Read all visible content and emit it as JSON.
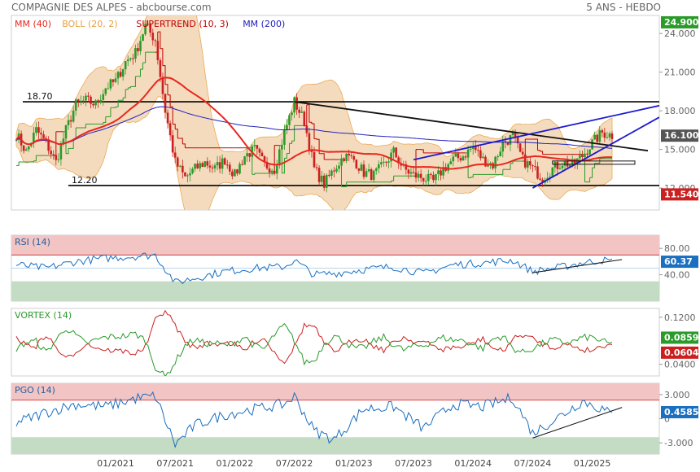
{
  "header": {
    "title": "COMPAGNIE DES ALPES - abcbourse.com",
    "period": "5 ANS - HEBDO"
  },
  "colors": {
    "mm40": "#e8281e",
    "boll": "#e8a040",
    "boll_fill": "#f4d8b8",
    "supertrend": "#c00000",
    "mm200": "#2020c0",
    "green": "#2a9a2a",
    "red": "#cc2020",
    "blue": "#1a6fc0",
    "overbought": "#f2c4c4",
    "oversold": "#c4dcc4"
  },
  "chart_data": [
    {
      "id": "price",
      "type": "candlestick",
      "legend": [
        {
          "key": "mm40",
          "label": "MM (40)"
        },
        {
          "key": "boll",
          "label": "BOLL (20, 2)"
        },
        {
          "key": "supertrend",
          "label": "SUPERTREND (10, 3)"
        },
        {
          "key": "mm200",
          "label": "MM (200)"
        }
      ],
      "ylim": [
        10.3,
        25.4
      ],
      "yticks": [
        "24.000",
        "21.000",
        "18.000",
        "15.000",
        "12.000"
      ],
      "ytick_values": [
        24,
        21,
        18,
        15,
        12
      ],
      "xticks": [
        "01/2021",
        "07/2021",
        "01/2022",
        "07/2022",
        "01/2023",
        "07/2023",
        "01/2024",
        "07/2024",
        "01/2025"
      ],
      "xtick_dates": [
        "2021-01",
        "2021-07",
        "2022-01",
        "2022-07",
        "2023-01",
        "2023-07",
        "2024-01",
        "2024-07",
        "2025-01"
      ],
      "xrange": [
        "2020-03",
        "2025-03"
      ],
      "levels": [
        {
          "label": "18.70",
          "value": 18.7
        },
        {
          "label": "12.20",
          "value": 12.2
        }
      ],
      "price_tags": [
        {
          "label": "24.900",
          "value": 24.9,
          "color": "#2a9a2a"
        },
        {
          "label": "16.100",
          "value": 16.1,
          "color": "#555555"
        },
        {
          "label": "11.540",
          "value": 11.54,
          "color": "#cc2020"
        }
      ],
      "close_path": [
        [
          "2020-03",
          16.2
        ],
        [
          "2020-04",
          14.8
        ],
        [
          "2020-05",
          16.5
        ],
        [
          "2020-06",
          15.5
        ],
        [
          "2020-07",
          14.0
        ],
        [
          "2020-08",
          16.5
        ],
        [
          "2020-09",
          18.5
        ],
        [
          "2020-10",
          18.8
        ],
        [
          "2020-11",
          18.5
        ],
        [
          "2020-12",
          19.8
        ],
        [
          "2021-01",
          20.3
        ],
        [
          "2021-02",
          21.8
        ],
        [
          "2021-03",
          22.5
        ],
        [
          "2021-04",
          24.6
        ],
        [
          "2021-05",
          23.5
        ],
        [
          "2021-06",
          18.0
        ],
        [
          "2021-07",
          14.0
        ],
        [
          "2021-08",
          12.8
        ],
        [
          "2021-09",
          13.5
        ],
        [
          "2021-10",
          14.0
        ],
        [
          "2021-11",
          13.5
        ],
        [
          "2021-12",
          14.2
        ],
        [
          "2022-01",
          13.0
        ],
        [
          "2022-02",
          14.5
        ],
        [
          "2022-03",
          15.0
        ],
        [
          "2022-04",
          13.8
        ],
        [
          "2022-05",
          13.5
        ],
        [
          "2022-06",
          16.3
        ],
        [
          "2022-07",
          18.7
        ],
        [
          "2022-08",
          17.2
        ],
        [
          "2022-09",
          13.5
        ],
        [
          "2022-10",
          12.3
        ],
        [
          "2022-11",
          13.5
        ],
        [
          "2022-12",
          14.5
        ],
        [
          "2023-01",
          14.2
        ],
        [
          "2023-02",
          13.2
        ],
        [
          "2023-03",
          13.0
        ],
        [
          "2023-04",
          13.8
        ],
        [
          "2023-05",
          14.8
        ],
        [
          "2023-06",
          13.5
        ],
        [
          "2023-07",
          13.0
        ],
        [
          "2023-08",
          12.8
        ],
        [
          "2023-09",
          12.5
        ],
        [
          "2023-10",
          13.5
        ],
        [
          "2023-11",
          14.2
        ],
        [
          "2023-12",
          14.5
        ],
        [
          "2024-01",
          15.2
        ],
        [
          "2024-02",
          14.2
        ],
        [
          "2024-03",
          13.8
        ],
        [
          "2024-04",
          15.5
        ],
        [
          "2024-05",
          16.0
        ],
        [
          "2024-06",
          14.2
        ],
        [
          "2024-07",
          13.5
        ],
        [
          "2024-08",
          12.8
        ],
        [
          "2024-09",
          13.5
        ],
        [
          "2024-10",
          14.0
        ],
        [
          "2024-11",
          13.8
        ],
        [
          "2024-12",
          14.5
        ],
        [
          "2025-01",
          15.5
        ],
        [
          "2025-02",
          16.3
        ],
        [
          "2025-03",
          16.1
        ]
      ]
    },
    {
      "id": "rsi",
      "type": "line",
      "title": "RSI (14)",
      "ylim": [
        0,
        100
      ],
      "yticks": [
        "80.00",
        "40.00"
      ],
      "ytick_values": [
        80,
        40
      ],
      "zones": {
        "overbought": 70,
        "oversold": 30
      },
      "last_value": "60.37",
      "path": [
        [
          "2020-03",
          55
        ],
        [
          "2020-06",
          50
        ],
        [
          "2020-09",
          60
        ],
        [
          "2020-12",
          65
        ],
        [
          "2021-03",
          68
        ],
        [
          "2021-05",
          70
        ],
        [
          "2021-07",
          28
        ],
        [
          "2021-09",
          35
        ],
        [
          "2021-12",
          45
        ],
        [
          "2022-03",
          50
        ],
        [
          "2022-06",
          52
        ],
        [
          "2022-07",
          62
        ],
        [
          "2022-09",
          40
        ],
        [
          "2022-11",
          42
        ],
        [
          "2023-02",
          48
        ],
        [
          "2023-05",
          52
        ],
        [
          "2023-08",
          42
        ],
        [
          "2023-11",
          55
        ],
        [
          "2024-02",
          58
        ],
        [
          "2024-05",
          62
        ],
        [
          "2024-07",
          45
        ],
        [
          "2024-10",
          52
        ],
        [
          "2024-12",
          58
        ],
        [
          "2025-02",
          62
        ],
        [
          "2025-03",
          60
        ]
      ],
      "trendline": [
        [
          "2024-07",
          43
        ],
        [
          "2025-04",
          63
        ]
      ]
    },
    {
      "id": "vortex",
      "type": "line",
      "title": "VORTEX (14)",
      "ylim": [
        0.02,
        0.135
      ],
      "yticks": [
        "0.1200",
        "0.0400"
      ],
      "ytick_values": [
        0.12,
        0.04
      ],
      "series": [
        {
          "color_key": "green",
          "last_value": "0.0859"
        },
        {
          "color_key": "red",
          "last_value": "0.0604"
        }
      ]
    },
    {
      "id": "pgo",
      "type": "line",
      "title": "PGO (14)",
      "ylim": [
        -4.4,
        4.4
      ],
      "yticks": [
        "3.000",
        "0",
        "-3.000"
      ],
      "ytick_values": [
        3,
        0,
        -3
      ],
      "zones": {
        "overbought": 2.3,
        "oversold": -2.3
      },
      "last_value": "0.4585",
      "path": [
        [
          "2020-03",
          -0.5
        ],
        [
          "2020-06",
          0.8
        ],
        [
          "2020-09",
          1.8
        ],
        [
          "2020-12",
          1.5
        ],
        [
          "2021-03",
          2.5
        ],
        [
          "2021-05",
          2.8
        ],
        [
          "2021-07",
          -3.2
        ],
        [
          "2021-09",
          -0.8
        ],
        [
          "2021-12",
          0.5
        ],
        [
          "2022-03",
          1.2
        ],
        [
          "2022-06",
          1.8
        ],
        [
          "2022-07",
          2.8
        ],
        [
          "2022-09",
          -1.5
        ],
        [
          "2022-11",
          -2.6
        ],
        [
          "2023-02",
          1.2
        ],
        [
          "2023-05",
          1.5
        ],
        [
          "2023-08",
          -1.2
        ],
        [
          "2023-11",
          1.8
        ],
        [
          "2024-02",
          1.5
        ],
        [
          "2024-05",
          2.6
        ],
        [
          "2024-07",
          -1.8
        ],
        [
          "2024-10",
          0.5
        ],
        [
          "2024-12",
          2.2
        ],
        [
          "2025-02",
          1.2
        ],
        [
          "2025-03",
          0.46
        ]
      ],
      "trendline": [
        [
          "2024-07",
          -2.4
        ],
        [
          "2025-04",
          1.4
        ]
      ]
    }
  ]
}
